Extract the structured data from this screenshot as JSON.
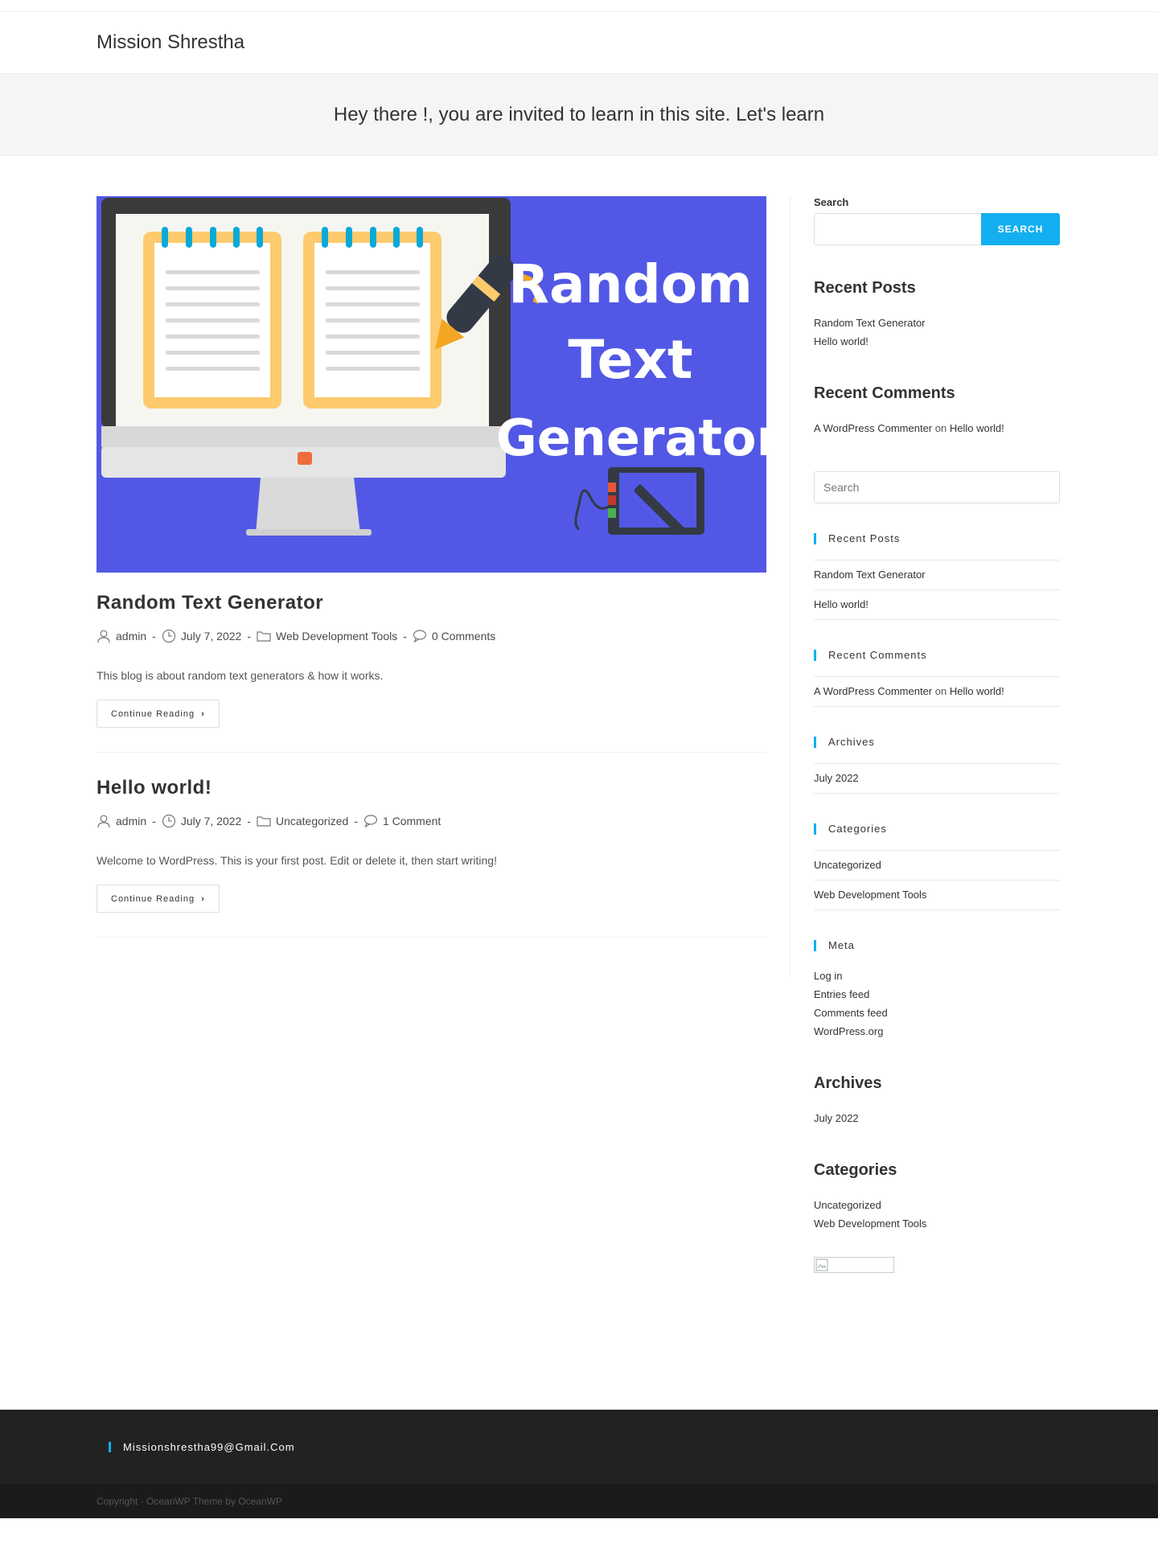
{
  "site": {
    "title": "Mission Shrestha"
  },
  "banner": {
    "text": "Hey there !, you are invited to learn in this site. Let's learn"
  },
  "featured": {
    "title_lines": [
      "Random",
      "Text",
      "Generator"
    ],
    "colors": {
      "bg": "#5258e5",
      "frame": "#3a3a3a",
      "notebook": "#fdcb6e",
      "ring": "#0aa9d6",
      "screen": "#f6f6f1"
    }
  },
  "posts": [
    {
      "title": "Random Text Generator",
      "author": "admin",
      "date": "July 7, 2022",
      "category": "Web Development Tools",
      "comments": "0 Comments",
      "excerpt": "This blog is about random text generators & how it works.",
      "continue_label": "Continue Reading"
    },
    {
      "title": "Hello world!",
      "author": "admin",
      "date": "July 7, 2022",
      "category": "Uncategorized",
      "comments": "1 Comment",
      "excerpt": "Welcome to WordPress. This is your first post. Edit or delete it, then start writing!",
      "continue_label": "Continue Reading"
    }
  ],
  "sidebar": {
    "search_label": "Search",
    "search_button": "SEARCH",
    "recent_posts_title": "Recent Posts",
    "recent_posts": [
      "Random Text Generator",
      "Hello world!"
    ],
    "recent_comments_title": "Recent Comments",
    "comment": {
      "author": "A WordPress Commenter",
      "on": "on",
      "post": "Hello world!"
    },
    "search_placeholder": "Search",
    "boxed": {
      "recent_posts_title": "Recent Posts",
      "recent_posts": [
        "Random Text Generator",
        "Hello world!"
      ],
      "recent_comments_title": "Recent Comments",
      "archives_title": "Archives",
      "archives": [
        "July 2022"
      ],
      "categories_title": "Categories",
      "categories": [
        "Uncategorized",
        "Web Development Tools"
      ],
      "meta_title": "Meta",
      "meta": [
        "Log in",
        "Entries feed",
        "Comments feed",
        "WordPress.org"
      ]
    },
    "archives_title": "Archives",
    "archives": [
      "July 2022"
    ],
    "categories_title": "Categories",
    "categories": [
      "Uncategorized",
      "Web Development Tools"
    ]
  },
  "footer": {
    "email": "Missionshrestha99@Gmail.Com",
    "copyright": "Copyright - OceanWP Theme by OceanWP"
  },
  "colors": {
    "accent": "#13aff0",
    "footer_bg": "#222222",
    "bottom_bg": "#1b1b1b"
  }
}
